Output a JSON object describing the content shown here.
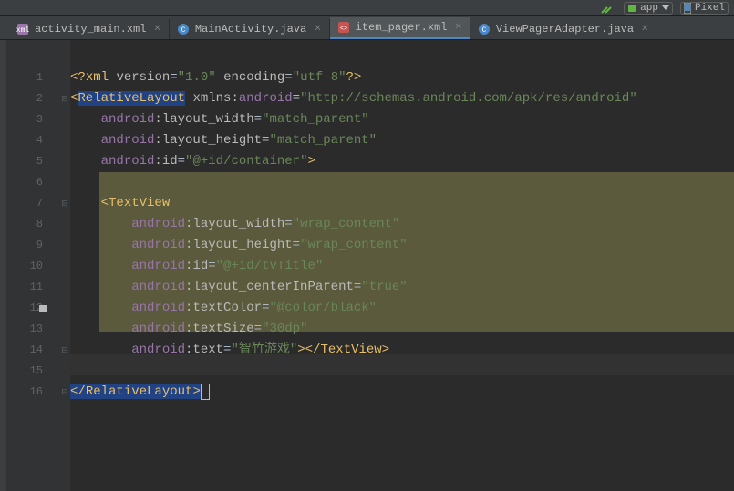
{
  "toolbar": {
    "run_config": "app",
    "device": "Pixel"
  },
  "tabs": [
    {
      "label": "activity_main.xml",
      "type": "xml",
      "active": false
    },
    {
      "label": "MainActivity.java",
      "type": "java",
      "active": false
    },
    {
      "label": "item_pager.xml",
      "type": "xml",
      "active": true
    },
    {
      "label": "ViewPagerAdapter.java",
      "type": "java",
      "active": false
    }
  ],
  "code": {
    "lines": 16,
    "line1": {
      "decl_open": "<?",
      "decl_name": "xml",
      "attr1": "version",
      "val1": "\"1.0\"",
      "attr2": "encoding",
      "val2": "\"utf-8\"",
      "decl_close": "?>"
    },
    "line2": {
      "open": "<",
      "tag": "RelativeLayout",
      "ns_attr": "xmlns:",
      "ns_name": "android",
      "ns_val": "\"http://schemas.android.com/apk/res/android\""
    },
    "line3": {
      "ns": "android",
      "sep": ":",
      "attr": "layout_width",
      "val": "\"match_parent\""
    },
    "line4": {
      "ns": "android",
      "sep": ":",
      "attr": "layout_height",
      "val": "\"match_parent\""
    },
    "line5": {
      "ns": "android",
      "sep": ":",
      "attr": "id",
      "val": "\"@+id/container\"",
      "close": ">"
    },
    "line7": {
      "open": "<",
      "tag": "TextView"
    },
    "line8": {
      "ns": "android",
      "sep": ":",
      "attr": "layout_width",
      "val": "\"wrap_content\""
    },
    "line9": {
      "ns": "android",
      "sep": ":",
      "attr": "layout_height",
      "val": "\"wrap_content\""
    },
    "line10": {
      "ns": "android",
      "sep": ":",
      "attr": "id",
      "val": "\"@+id/tvTitle\""
    },
    "line11": {
      "ns": "android",
      "sep": ":",
      "attr": "layout_centerInParent",
      "val": "\"true\""
    },
    "line12": {
      "ns": "android",
      "sep": ":",
      "attr": "textColor",
      "val": "\"@color/black\""
    },
    "line13": {
      "ns": "android",
      "sep": ":",
      "attr": "textSize",
      "val": "\"30dp\""
    },
    "line14": {
      "ns": "android",
      "sep": ":",
      "attr": "text",
      "val": "\"智竹游戏\"",
      "close": "></",
      "closetag": "TextView",
      "closeend": ">"
    },
    "line16": {
      "open": "</",
      "tag": "RelativeLayout",
      "close": ">"
    }
  }
}
